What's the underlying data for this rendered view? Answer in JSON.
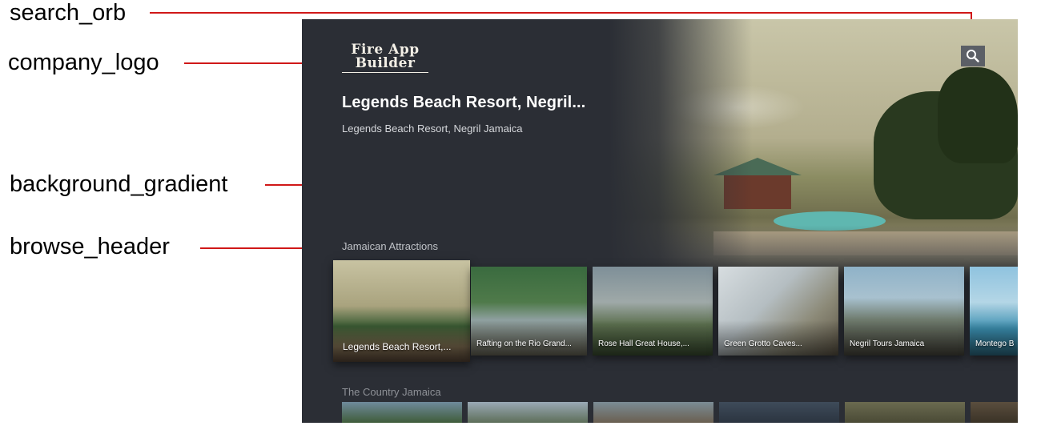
{
  "callouts": {
    "search_orb": "search_orb",
    "company_logo": "company_logo",
    "background_gradient": "background_gradient",
    "browse_header": "browse_header"
  },
  "app": {
    "logo_line1": "Fire App",
    "logo_line2": "Builder"
  },
  "details": {
    "title": "Legends Beach Resort, Negril...",
    "subtitle": "Legends Beach Resort, Negril Jamaica"
  },
  "search": {
    "icon": "search-icon"
  },
  "rows": [
    {
      "header": "Jamaican Attractions",
      "cards": [
        {
          "caption": "Legends Beach Resort,...",
          "focused": true
        },
        {
          "caption": "Rafting on the Rio Grand..."
        },
        {
          "caption": "Rose Hall Great House,..."
        },
        {
          "caption": "Green Grotto Caves..."
        },
        {
          "caption": "Negril Tours Jamaica"
        },
        {
          "caption": "Montego B"
        }
      ]
    },
    {
      "header": "The Country Jamaica"
    }
  ],
  "colors": {
    "screen_bg": "#2b2e35",
    "callout_line": "#d01818",
    "search_orb_bg": "#5b5f66"
  }
}
